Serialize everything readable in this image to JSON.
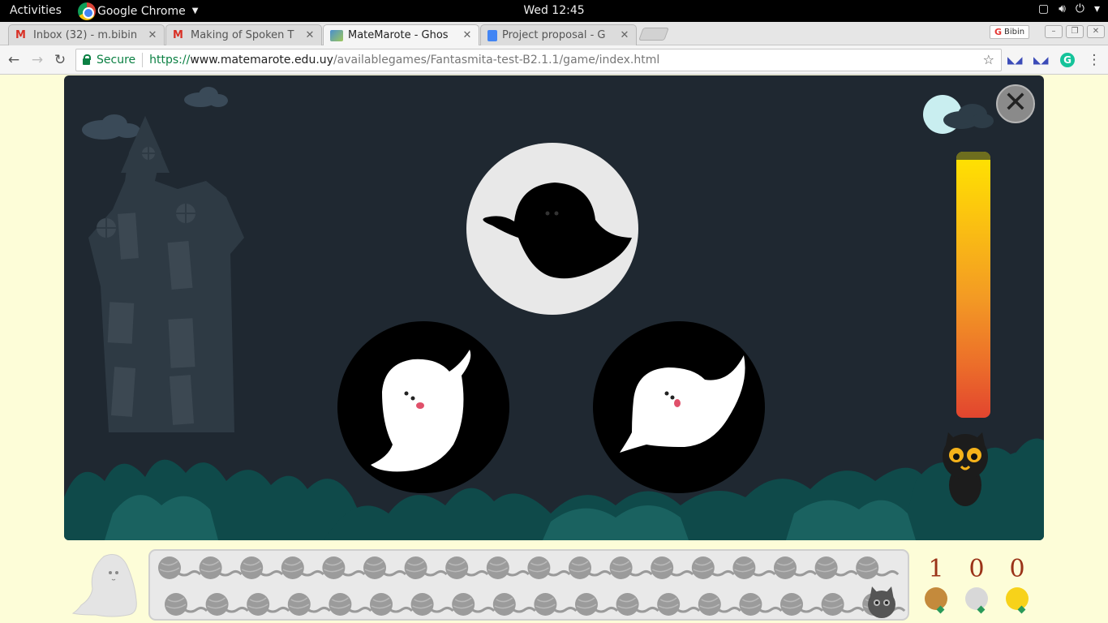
{
  "topbar": {
    "activities": "Activities",
    "app_name": "Google Chrome",
    "clock": "Wed 12:45"
  },
  "tabs": [
    {
      "title": "Inbox (32) - m.bibin",
      "favicon": "gmail-icon",
      "active": false
    },
    {
      "title": "Making of Spoken T",
      "favicon": "gmail-icon",
      "active": false
    },
    {
      "title": "MateMarote - Ghos",
      "favicon": "matemarote-icon",
      "active": true
    },
    {
      "title": "Project proposal - G",
      "favicon": "google-docs-icon",
      "active": false
    }
  ],
  "profile": {
    "name": "Bibin"
  },
  "address_bar": {
    "security_label": "Secure",
    "scheme": "https://",
    "host": "www.matemarote.edu.uy",
    "path": "/availablegames/Fantasmita-test-B2.1.1/game/index.html"
  },
  "game": {
    "target": {
      "description_icon": "ghost-silhouette-icon"
    },
    "options": [
      {
        "icon": "ghost-option-left-icon"
      },
      {
        "icon": "ghost-option-right-icon"
      }
    ],
    "meter_level": 1.0
  },
  "hud": {
    "yarn_total": 37,
    "scores": [
      {
        "value": "1",
        "medal": "bronze",
        "color": "#c48a3c"
      },
      {
        "value": "0",
        "medal": "silver",
        "color": "#d8d8d8"
      },
      {
        "value": "0",
        "medal": "gold",
        "color": "#f7d21a"
      }
    ]
  },
  "colors": {
    "game_bg": "#1f2831",
    "page_bg": "#fdfdd8",
    "bush": "#0f4a4a",
    "score_text": "#9a3318"
  }
}
